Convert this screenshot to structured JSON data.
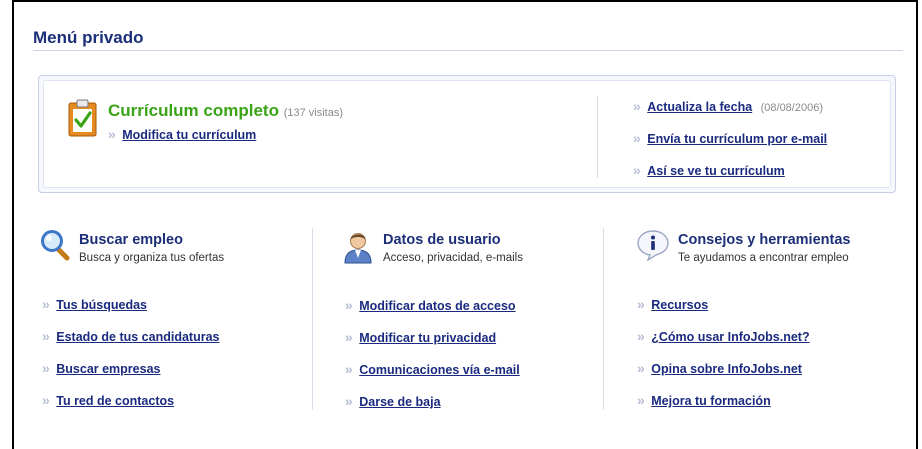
{
  "page_title": "Menú privado",
  "cv": {
    "status": "Currículum completo",
    "visits": "(137 visitas)",
    "edit_link": "Modifica tu currículum",
    "actions": [
      {
        "label": "Actualiza la fecha",
        "note": "(08/08/2006)"
      },
      {
        "label": "Envía tu currículum por e-mail"
      },
      {
        "label": "Así se ve tu currículum"
      }
    ]
  },
  "columns": [
    {
      "icon": "magnifier-icon",
      "title": "Buscar empleo",
      "subtitle": "Busca y organiza tus ofertas",
      "links": [
        "Tus búsquedas",
        "Estado de tus candidaturas",
        "Buscar empresas",
        "Tu red de contactos"
      ]
    },
    {
      "icon": "user-icon",
      "title": "Datos de usuario",
      "subtitle": "Acceso, privacidad, e-mails",
      "links": [
        "Modificar datos de acceso",
        "Modificar tu privacidad",
        "Comunicaciones vía e-mail",
        "Darse de baja"
      ]
    },
    {
      "icon": "info-bubble-icon",
      "title": "Consejos y herramientas",
      "subtitle": "Te ayudamos a encontrar empleo",
      "links": [
        "Recursos",
        "¿Cómo usar InfoJobs.net?",
        "Opina sobre InfoJobs.net",
        "Mejora tu formación"
      ]
    }
  ],
  "chevron_glyph": "»",
  "colors": {
    "title": "#1c2f78",
    "link": "#1a2a7e",
    "status_green": "#3aa316",
    "chevron": "#b7bfd6"
  }
}
